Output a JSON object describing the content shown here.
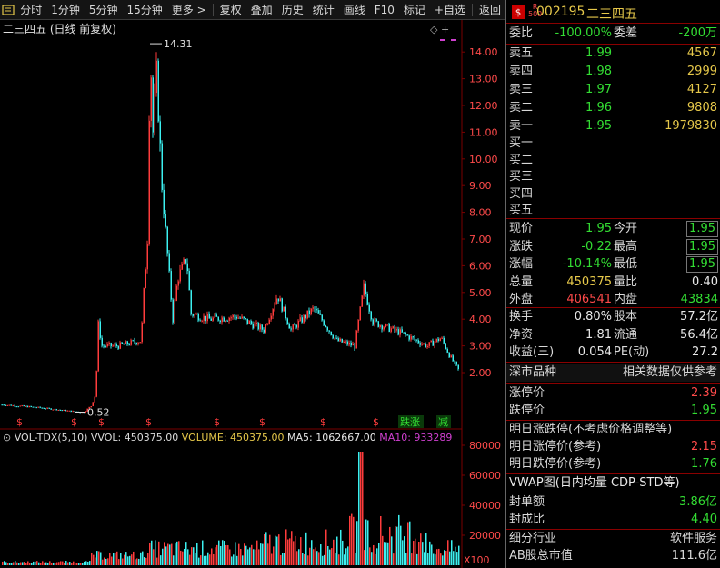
{
  "toolbar": {
    "items": [
      "分时",
      "1分钟",
      "5分钟",
      "15分钟",
      "更多 >",
      "复权",
      "叠加",
      "历史",
      "统计",
      "画线",
      "F10",
      "标记",
      "+自选",
      "返回"
    ]
  },
  "chart": {
    "title": "二三四五 (日线 前复权)",
    "high_label": "14.31",
    "low_label": "0.52",
    "ctrl_symbols": "◇  +",
    "y_axis_ticks": [
      "14.00",
      "13.00",
      "12.00",
      "11.00",
      "10.00",
      "9.00",
      "8.00",
      "7.00",
      "6.00",
      "5.00",
      "4.00",
      "3.00",
      "2.00"
    ],
    "markers": [
      "$",
      "$",
      "$",
      "$",
      "$",
      "$",
      "$",
      "$",
      "$",
      "$"
    ],
    "badge_down": "跌涨",
    "badge_cut": "减",
    "colors": {
      "up": "#ff3c3c",
      "down": "#3cf0f0",
      "grid": "#7a0000",
      "ma5": "#e8e8e8",
      "ma10": "#e6c84a"
    }
  },
  "volume": {
    "indicator": "VOL-TDX(5,10)",
    "vvol": "VVOL: 450375.00",
    "volume": "VOLUME: 450375.00",
    "ma5": "MA5: 1062667.00",
    "ma10": "MA10: 933289",
    "y_axis_ticks": [
      "80000",
      "60000",
      "40000",
      "20000"
    ],
    "multiplier": "X100"
  },
  "quote": {
    "r500": "R\n500",
    "code": "002195",
    "name": "二三四五",
    "weibi_label": "委比",
    "weibi": "-100.00%",
    "weicha_label": "委差",
    "weicha": "-200万",
    "sell": [
      {
        "label": "卖五",
        "price": "1.99",
        "vol": "4567"
      },
      {
        "label": "卖四",
        "price": "1.98",
        "vol": "2999"
      },
      {
        "label": "卖三",
        "price": "1.97",
        "vol": "4127"
      },
      {
        "label": "卖二",
        "price": "1.96",
        "vol": "9808"
      },
      {
        "label": "卖一",
        "price": "1.95",
        "vol": "1979830"
      }
    ],
    "buy": [
      {
        "label": "买一"
      },
      {
        "label": "买二"
      },
      {
        "label": "买三"
      },
      {
        "label": "买四"
      },
      {
        "label": "买五"
      }
    ],
    "stats": [
      {
        "l1": "现价",
        "v1": "1.95",
        "l2": "今开",
        "v2": "1.95"
      },
      {
        "l1": "涨跌",
        "v1": "-0.22",
        "l2": "最高",
        "v2": "1.95"
      },
      {
        "l1": "涨幅",
        "v1": "-10.14%",
        "l2": "最低",
        "v2": "1.95"
      },
      {
        "l1": "总量",
        "v1": "450375",
        "l2": "量比",
        "v2": "0.40"
      },
      {
        "l1": "外盘",
        "v1": "406541",
        "l2": "内盘",
        "v2": "43834"
      },
      {
        "l1": "换手",
        "v1": "0.80%",
        "l2": "股本",
        "v2": "57.2亿"
      },
      {
        "l1": "净资",
        "v1": "1.81",
        "l2": "流通",
        "v2": "56.4亿"
      },
      {
        "l1": "收益(三)",
        "v1": "0.054",
        "l2": "PE(动)",
        "v2": "27.2"
      }
    ],
    "section_left": "深市品种",
    "section_right": "相关数据仅供参考",
    "limit_up_label": "涨停价",
    "limit_up": "2.39",
    "limit_down_label": "跌停价",
    "limit_down": "1.95",
    "tomorrow_note": "明日涨跌停(不考虑价格调整等)",
    "tomorrow_up_label": "明日涨停价(参考)",
    "tomorrow_up": "2.15",
    "tomorrow_down_label": "明日跌停价(参考)",
    "tomorrow_down": "1.76",
    "vwap": "VWAP图(日内均量 CDP-STD等)",
    "fengdan_label": "封单额",
    "fengdan": "3.86亿",
    "fengcheng_label": "封成比",
    "fengcheng": "4.40",
    "industry_label": "细分行业",
    "industry": "软件服务",
    "mktcap_label": "AB股总市值",
    "mktcap": "111.6亿"
  }
}
